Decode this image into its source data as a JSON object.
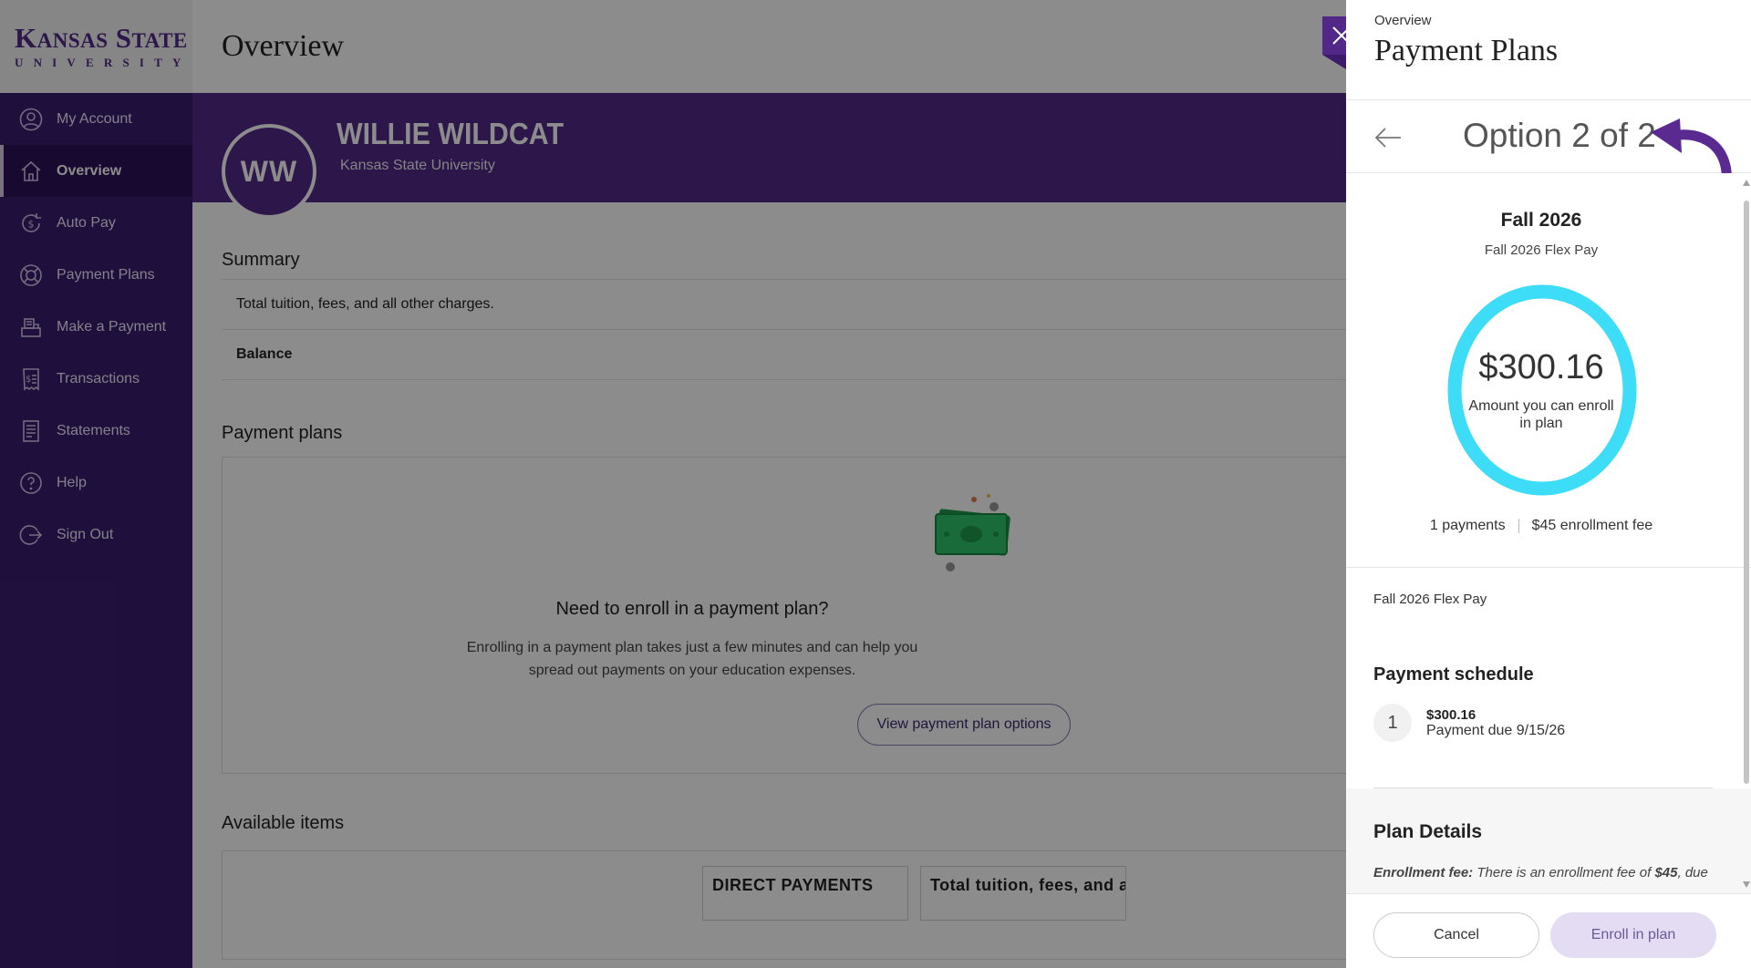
{
  "brand": {
    "line1_k": "K",
    "line1_ansas": "ANSAS",
    "line1_s": "S",
    "line1_tate": "TATE",
    "line2": "UNIVERSITY"
  },
  "sidebar": {
    "items": [
      {
        "label": "My Account",
        "icon": "user-circle-icon"
      },
      {
        "label": "Overview",
        "icon": "home-icon"
      },
      {
        "label": "Auto Pay",
        "icon": "dollar-cycle-icon"
      },
      {
        "label": "Payment Plans",
        "icon": "life-ring-icon"
      },
      {
        "label": "Make a Payment",
        "icon": "register-icon"
      },
      {
        "label": "Transactions",
        "icon": "receipt-icon"
      },
      {
        "label": "Statements",
        "icon": "document-icon"
      },
      {
        "label": "Help",
        "icon": "question-icon"
      },
      {
        "label": "Sign Out",
        "icon": "sign-out-icon"
      }
    ],
    "active": "Overview"
  },
  "main": {
    "title": "Overview",
    "profile": {
      "initials": "WW",
      "name": "WILLIE WILDCAT",
      "institution": "Kansas State University"
    },
    "summary": {
      "title": "Summary",
      "row1": "Total tuition, fees, and all other charges.",
      "row2": "Balance"
    },
    "plans": {
      "title": "Payment plans",
      "question": "Need to enroll in a payment plan?",
      "desc_line1": "Enrolling in a payment plan takes just a few minutes and can help you",
      "desc_line2": "spread out payments on your education expenses.",
      "button": "View payment plan options"
    },
    "available": {
      "title": "Available items",
      "col1": "DIRECT PAYMENTS",
      "col2": "Total tuition, fees, and all"
    }
  },
  "panel": {
    "crumb": "Overview",
    "title": "Payment Plans",
    "option_text": "Option 2 of 2",
    "term": "Fall 2026",
    "term_sub": "Fall 2026 Flex Pay",
    "amount": "$300.16",
    "amount_label": "Amount you can enroll in plan",
    "payments_count": "1 payments",
    "enrollment_fee": "$45 enrollment fee",
    "plan_name": "Fall 2026 Flex Pay",
    "schedule_title": "Payment schedule",
    "schedule": [
      {
        "num": "1",
        "amount": "$300.16",
        "due": "Payment due 9/15/26"
      }
    ],
    "details_title": "Plan Details",
    "details_label": "Enrollment fee:",
    "details_text": " There is an enrollment fee of ",
    "details_fee": "$45",
    "details_tail": ", due",
    "cancel": "Cancel",
    "enroll": "Enroll in plan"
  },
  "colors": {
    "brand_purple": "#512888",
    "sidebar": "#3a1d70",
    "ring": "#3ddcf7",
    "annotation_arrow": "#5a2a91"
  }
}
